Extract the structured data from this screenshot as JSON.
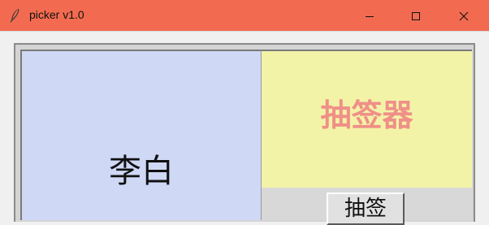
{
  "window": {
    "title": "picker v1.0",
    "titlebar_color": "#f26b50",
    "icons": {
      "app": "feather-icon",
      "minimize": "minimize-icon",
      "maximize": "maximize-icon",
      "close": "close-icon"
    }
  },
  "main": {
    "result_name": "李白",
    "heading": "抽签器",
    "draw_button_label": "抽签",
    "colors": {
      "left_panel": "#cfd8f5",
      "right_panel": "#f3f3a7",
      "heading_text": "#f08f88"
    }
  }
}
